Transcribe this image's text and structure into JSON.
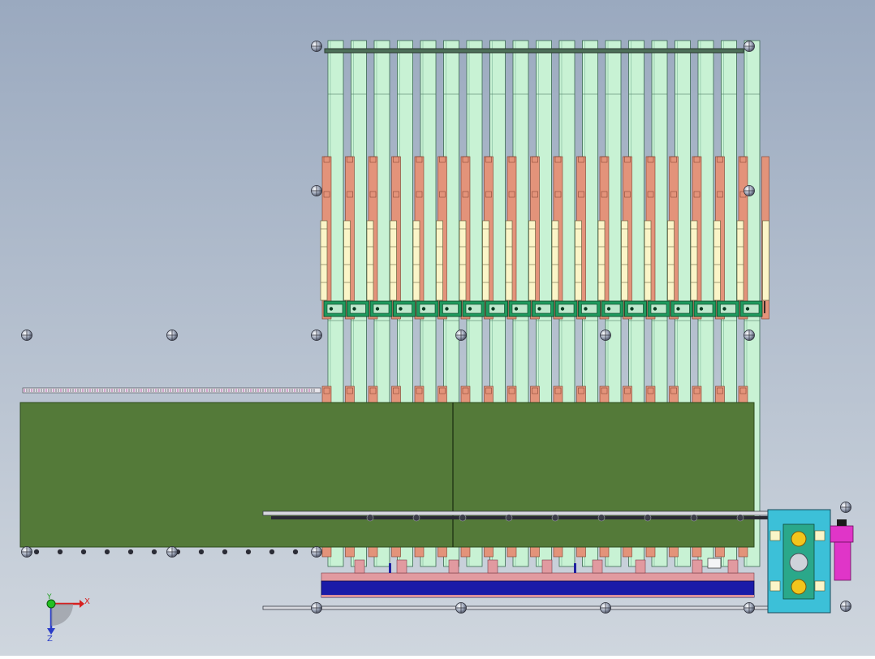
{
  "viewport": {
    "background_top": "#9aa9bf",
    "background_bottom": "#cfd6de"
  },
  "colors": {
    "slat_fill": "#c8f2d4",
    "slat_stroke": "#3c6a52",
    "pad_fill": "#e3937a",
    "pad_stroke": "#7d3c2a",
    "cylinder_fill": "#fbf5c8",
    "clamp_fill": "#1f9a5e",
    "plate_fill": "#547a39",
    "plate_stroke": "#2c4a1c",
    "rail_fill": "#8f8f94",
    "bluebar_fill": "#1a1aa8",
    "drive_fill": "#3cc0d8",
    "gear_fill": "#f3c51c",
    "motor_fill": "#e035c8"
  },
  "drawing": {
    "slat_count": 19
  },
  "triad": {
    "x_label": "X",
    "y_label": "Y",
    "z_label": "Z"
  }
}
